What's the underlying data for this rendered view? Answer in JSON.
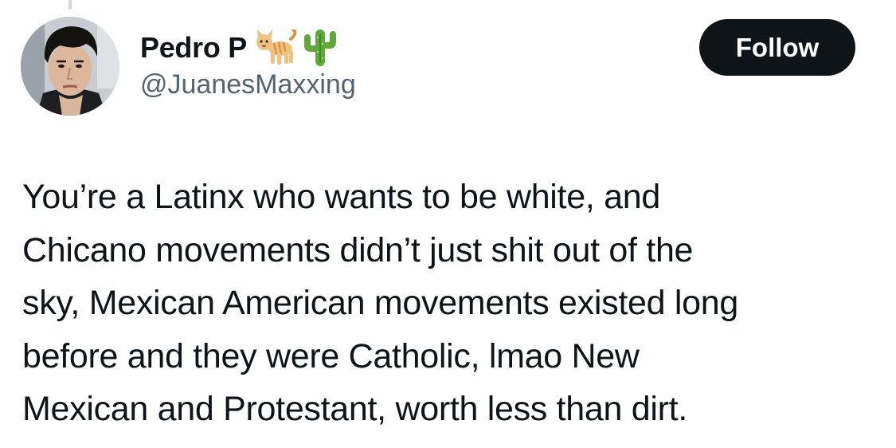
{
  "author": {
    "display_name": "Pedro P",
    "name_emojis": [
      "cat-emoji",
      "cactus-emoji"
    ],
    "handle": "@JuanesMaxxing",
    "avatar_icon": "profile-photo"
  },
  "actions": {
    "follow_label": "Follow"
  },
  "tweet": {
    "lines": [
      "You’re a Latinx who wants to be white, and",
      "Chicano movements didn’t just shit out of the",
      "sky, Mexican American movements existed long",
      "before and they were Catholic, lmao New",
      "Mexican and Protestant, worth less than dirt."
    ]
  },
  "colors": {
    "text_primary": "#0f1419",
    "text_secondary": "#536471",
    "button_bg": "#0f1419",
    "button_text": "#ffffff",
    "thread_line": "#cfd9de"
  }
}
